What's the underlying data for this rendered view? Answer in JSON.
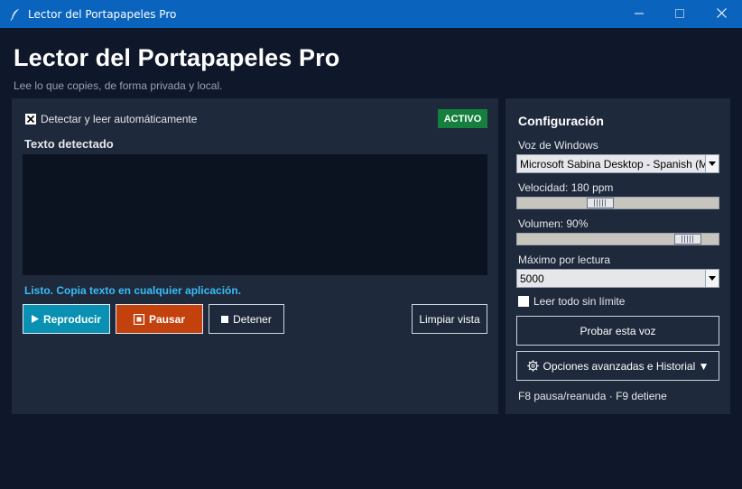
{
  "window": {
    "title": "Lector del Portapapeles Pro",
    "icons": {
      "app": "feather-icon",
      "minimize": "minimize-icon",
      "maximize": "maximize-icon",
      "close": "close-icon"
    }
  },
  "header": {
    "title": "Lector del Portapapeles Pro",
    "subtitle": "Lee lo que copies, de forma privada y local."
  },
  "reader": {
    "auto_detect_label": "Detectar y leer automáticamente",
    "auto_detect_checked": true,
    "status_badge": "ACTIVO",
    "detected_text_label": "Texto detectado",
    "detected_text_value": "",
    "status_message": "Listo. Copia texto en cualquier aplicación.",
    "buttons": {
      "play": "Reproducir",
      "pause": "Pausar",
      "stop": "Detener",
      "clear": "Limpiar vista"
    }
  },
  "config": {
    "title": "Configuración",
    "voice_label": "Voz de Windows",
    "voice_value": "Microsoft Sabina Desktop - Spanish (M",
    "speed_label": "Velocidad: 180 ppm",
    "speed_fraction": 0.4,
    "volume_label": "Volumen: 90%",
    "volume_fraction": 0.9,
    "max_label": "Máximo por lectura",
    "max_value": "5000",
    "read_all_label": "Leer todo sin límite",
    "read_all_checked": false,
    "test_voice_button": "Probar esta voz",
    "advanced_button": "Opciones avanzadas e Historial ▼",
    "hotkeys_hint": "F8 pausa/reanuda · F9 detiene"
  },
  "colors": {
    "background": "#0f172a",
    "panel": "#1e293b",
    "titlebar": "#0a64be",
    "accent_cyan": "#0891b2",
    "accent_orange": "#c2410c",
    "badge_green": "#15803d",
    "status_text": "#38bdf8"
  }
}
